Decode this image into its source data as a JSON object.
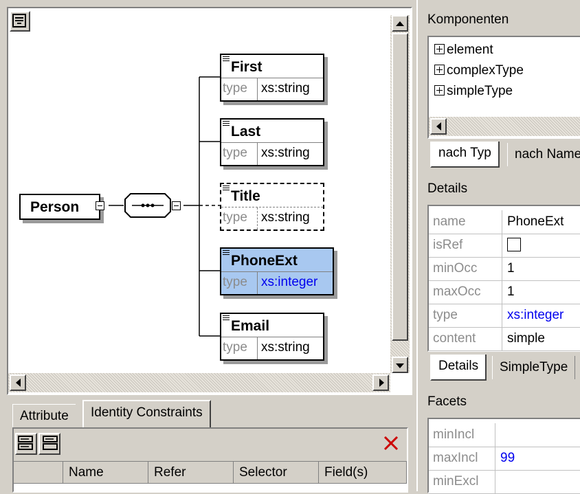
{
  "diagram": {
    "root": "Person",
    "sequence_symbol": "•••",
    "elements": [
      {
        "name": "First",
        "type_key": "type",
        "type_value": "xs:string"
      },
      {
        "name": "Last",
        "type_key": "type",
        "type_value": "xs:string"
      },
      {
        "name": "Title",
        "type_key": "type",
        "type_value": "xs:string"
      },
      {
        "name": "PhoneExt",
        "type_key": "type",
        "type_value": "xs:integer"
      },
      {
        "name": "Email",
        "type_key": "type",
        "type_value": "xs:string"
      }
    ]
  },
  "bottom_panel": {
    "tabs": [
      "Attribute",
      "Identity Constraints"
    ],
    "columns": [
      "Name",
      "Refer",
      "Selector",
      "Field(s)"
    ]
  },
  "components": {
    "title": "Komponenten",
    "items": [
      "element",
      "complexType",
      "simpleType"
    ],
    "tabs": [
      "nach Typ",
      "nach Name"
    ]
  },
  "details": {
    "title": "Details",
    "rows": [
      {
        "key": "name",
        "value": "PhoneExt"
      },
      {
        "key": "isRef",
        "value": ""
      },
      {
        "key": "minOcc",
        "value": "1"
      },
      {
        "key": "maxOcc",
        "value": "1"
      },
      {
        "key": "type",
        "value": "xs:integer"
      },
      {
        "key": "content",
        "value": "simple"
      }
    ],
    "tabs": [
      "Details",
      "SimpleType"
    ]
  },
  "facets": {
    "title": "Facets",
    "rows": [
      {
        "key": "minIncl",
        "value": ""
      },
      {
        "key": "maxIncl",
        "value": "99"
      },
      {
        "key": "minExcl",
        "value": ""
      }
    ]
  },
  "colors": {
    "selected_bg": "#a8c8f0",
    "link_blue": "#0000ee",
    "delete_red": "#cc0000"
  }
}
